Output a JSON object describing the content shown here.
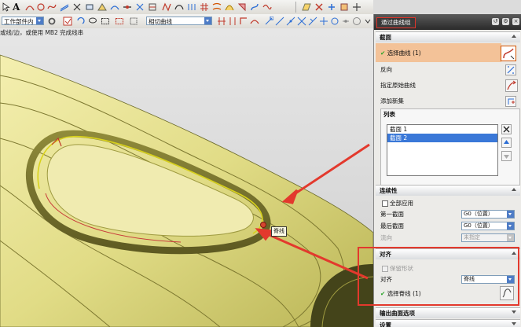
{
  "toolbar": {
    "filter_value": "工作部件内",
    "curve_rule_value": "相切曲线"
  },
  "viewport": {
    "status_text": "或线/边，或使用 MB2 完成线串",
    "tooltip": "脊线"
  },
  "dialog": {
    "title": "通过曲线组",
    "sections": {
      "section_header": "截面",
      "select_curve_label": "选择曲线 (1)",
      "reverse_label": "反向",
      "start_curve_label": "指定原始曲线",
      "add_set_label": "添加新集",
      "list_header": "列表",
      "list_items": [
        "截面 1",
        "截面 2"
      ]
    },
    "continuity": {
      "header": "连续性",
      "apply_all_label": "全部应用",
      "first_section_label": "第一截面",
      "first_section_value": "G0（位置）",
      "last_section_label": "最后截面",
      "last_section_value": "G0（位置）",
      "flow_label": "流向",
      "flow_value": "未指定"
    },
    "alignment": {
      "header": "对齐",
      "preserve_shape_label": "保留形状",
      "align_label": "对齐",
      "align_value": "脊线",
      "select_spine_label": "选择脊线 (1)"
    },
    "output_surface_header": "输出曲面选项",
    "settings_header": "设置"
  },
  "colors": {
    "accent_red": "#e3392d",
    "select_highlight": "#f3c298",
    "list_selection": "#3a78d8",
    "model_yellow": "#e4e08a"
  }
}
